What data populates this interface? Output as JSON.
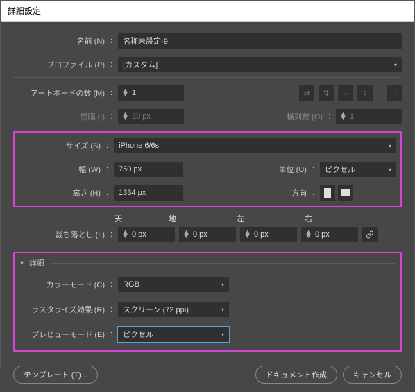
{
  "title": "詳細設定",
  "name": {
    "label": "名前 (N)",
    "value": "名称未設定-9"
  },
  "profile": {
    "label": "プロファイル (P)",
    "value": "[カスタム]"
  },
  "artboards": {
    "label": "アートボードの数 (M)",
    "value": "1"
  },
  "spacing": {
    "label": "間隔 (I)",
    "value": "20 px"
  },
  "columns": {
    "label": "横列数 (O)",
    "value": "1"
  },
  "size": {
    "label": "サイズ (S)",
    "value": "iPhone 6/6s"
  },
  "width": {
    "label": "幅 (W)",
    "value": "750 px"
  },
  "height": {
    "label": "高さ (H)",
    "value": "1334 px"
  },
  "units": {
    "label": "単位 (U)",
    "value": "ピクセル"
  },
  "orientation": {
    "label": "方向"
  },
  "bleed": {
    "label": "裁ち落とし (L)",
    "top_h": "天",
    "bottom_h": "地",
    "left_h": "左",
    "right_h": "右",
    "top": "0 px",
    "bottom": "0 px",
    "left": "0 px",
    "right": "0 px"
  },
  "details_header": "詳細",
  "colormode": {
    "label": "カラーモード (C)",
    "value": "RGB"
  },
  "raster": {
    "label": "ラスタライズ効果 (R)",
    "value": "スクリーン (72 ppi)"
  },
  "preview": {
    "label": "プレビューモード (E)",
    "value": "ピクセル"
  },
  "buttons": {
    "template": "テンプレート (T)...",
    "create": "ドキュメント作成",
    "cancel": "キャンセル"
  }
}
